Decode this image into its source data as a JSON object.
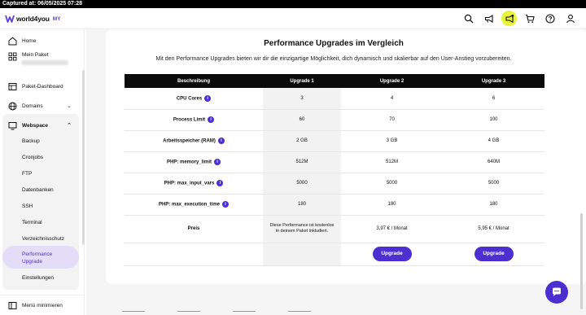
{
  "capture": {
    "text": "Captured at: 06/05/2025 07:28"
  },
  "brand": {
    "name": "world4you",
    "suffix": "MY",
    "accent": "#4b2fd0",
    "highlight": "#e9f33a"
  },
  "topbar": {
    "icons": [
      "search-icon",
      "megaphone-icon",
      "news-icon",
      "cart-icon",
      "help-icon",
      "user-icon"
    ]
  },
  "sidebar": {
    "home": "Home",
    "mein_paket": "Mein Paket",
    "paket_dashboard": "Paket-Dashboard",
    "domains": "Domains",
    "webspace": "Webspace",
    "sub_items": [
      "Backup",
      "Cronjobs",
      "FTP",
      "Datenbanken",
      "SSH",
      "Terminal",
      "Verzeichnisschutz",
      "Performance Upgrade",
      "Einstellungen"
    ],
    "minimize": "Menü minimieren"
  },
  "main": {
    "title": "Performance Upgrades im Vergleich",
    "subtitle": "Mit den Performance Upgrades bieten wir dir die einzigartige Möglichkeit, dich dynamisch und skalierbar auf den User-Anstieg vorzubereiten.",
    "table": {
      "headers": [
        "Beschreibung",
        "Upgrade 1",
        "Upgrade 2",
        "Upgrade 3"
      ],
      "rows": [
        {
          "label": "CPU Cores",
          "values": [
            "3",
            "4",
            "6"
          ]
        },
        {
          "label": "Process Limit",
          "values": [
            "60",
            "70",
            "100"
          ]
        },
        {
          "label": "Arbeitsspeicher (RAM)",
          "values": [
            "2 GB",
            "3 GB",
            "4 GB"
          ]
        },
        {
          "label": "PHP: memory_limit",
          "values": [
            "512M",
            "512M",
            "640M"
          ]
        },
        {
          "label": "PHP: max_input_vars",
          "values": [
            "5000",
            "5000",
            "5000"
          ]
        },
        {
          "label": "PHP: max_execution_time",
          "values": [
            "180",
            "180",
            "180"
          ]
        }
      ],
      "preis_label": "Preis",
      "preis": [
        "Diese Performance ist kostenlos in deinem Paket inkludiert.",
        "3,97 € / Monat",
        "5,95 € / Monat"
      ],
      "button_label": "Upgrade",
      "info_glyph": "i"
    }
  }
}
